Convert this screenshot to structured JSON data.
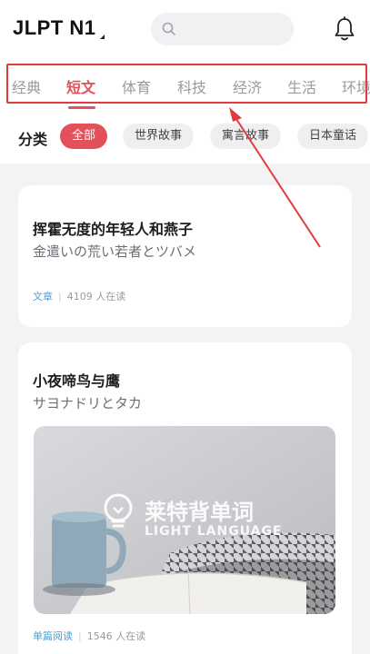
{
  "header": {
    "app_title": "JLPT N1",
    "search_placeholder": ""
  },
  "tabs": [
    {
      "label": "经典"
    },
    {
      "label": "短文"
    },
    {
      "label": "体育"
    },
    {
      "label": "科技"
    },
    {
      "label": "经济"
    },
    {
      "label": "生活"
    },
    {
      "label": "环境"
    }
  ],
  "categories": {
    "label": "分类",
    "chips": [
      {
        "label": "全部"
      },
      {
        "label": "世界故事"
      },
      {
        "label": "寓言故事"
      },
      {
        "label": "日本童话"
      }
    ]
  },
  "articles": [
    {
      "title": "挥霍无度的年轻人和燕子",
      "subtitle": "金遣いの荒い若者とツバメ",
      "tag": "文章",
      "readers": "4109 人在读"
    },
    {
      "title": "小夜啼鸟与鹰",
      "subtitle": "サヨナドリとタカ",
      "image_brand": "莱特背单词",
      "image_brand_en": "LIGHT LANGUAGE",
      "tag": "单篇阅读",
      "readers": "1546 人在读"
    }
  ],
  "colors": {
    "accent": "#e2505a",
    "annotation": "#e23b3b",
    "tag_blue": "#4a9fd6"
  }
}
